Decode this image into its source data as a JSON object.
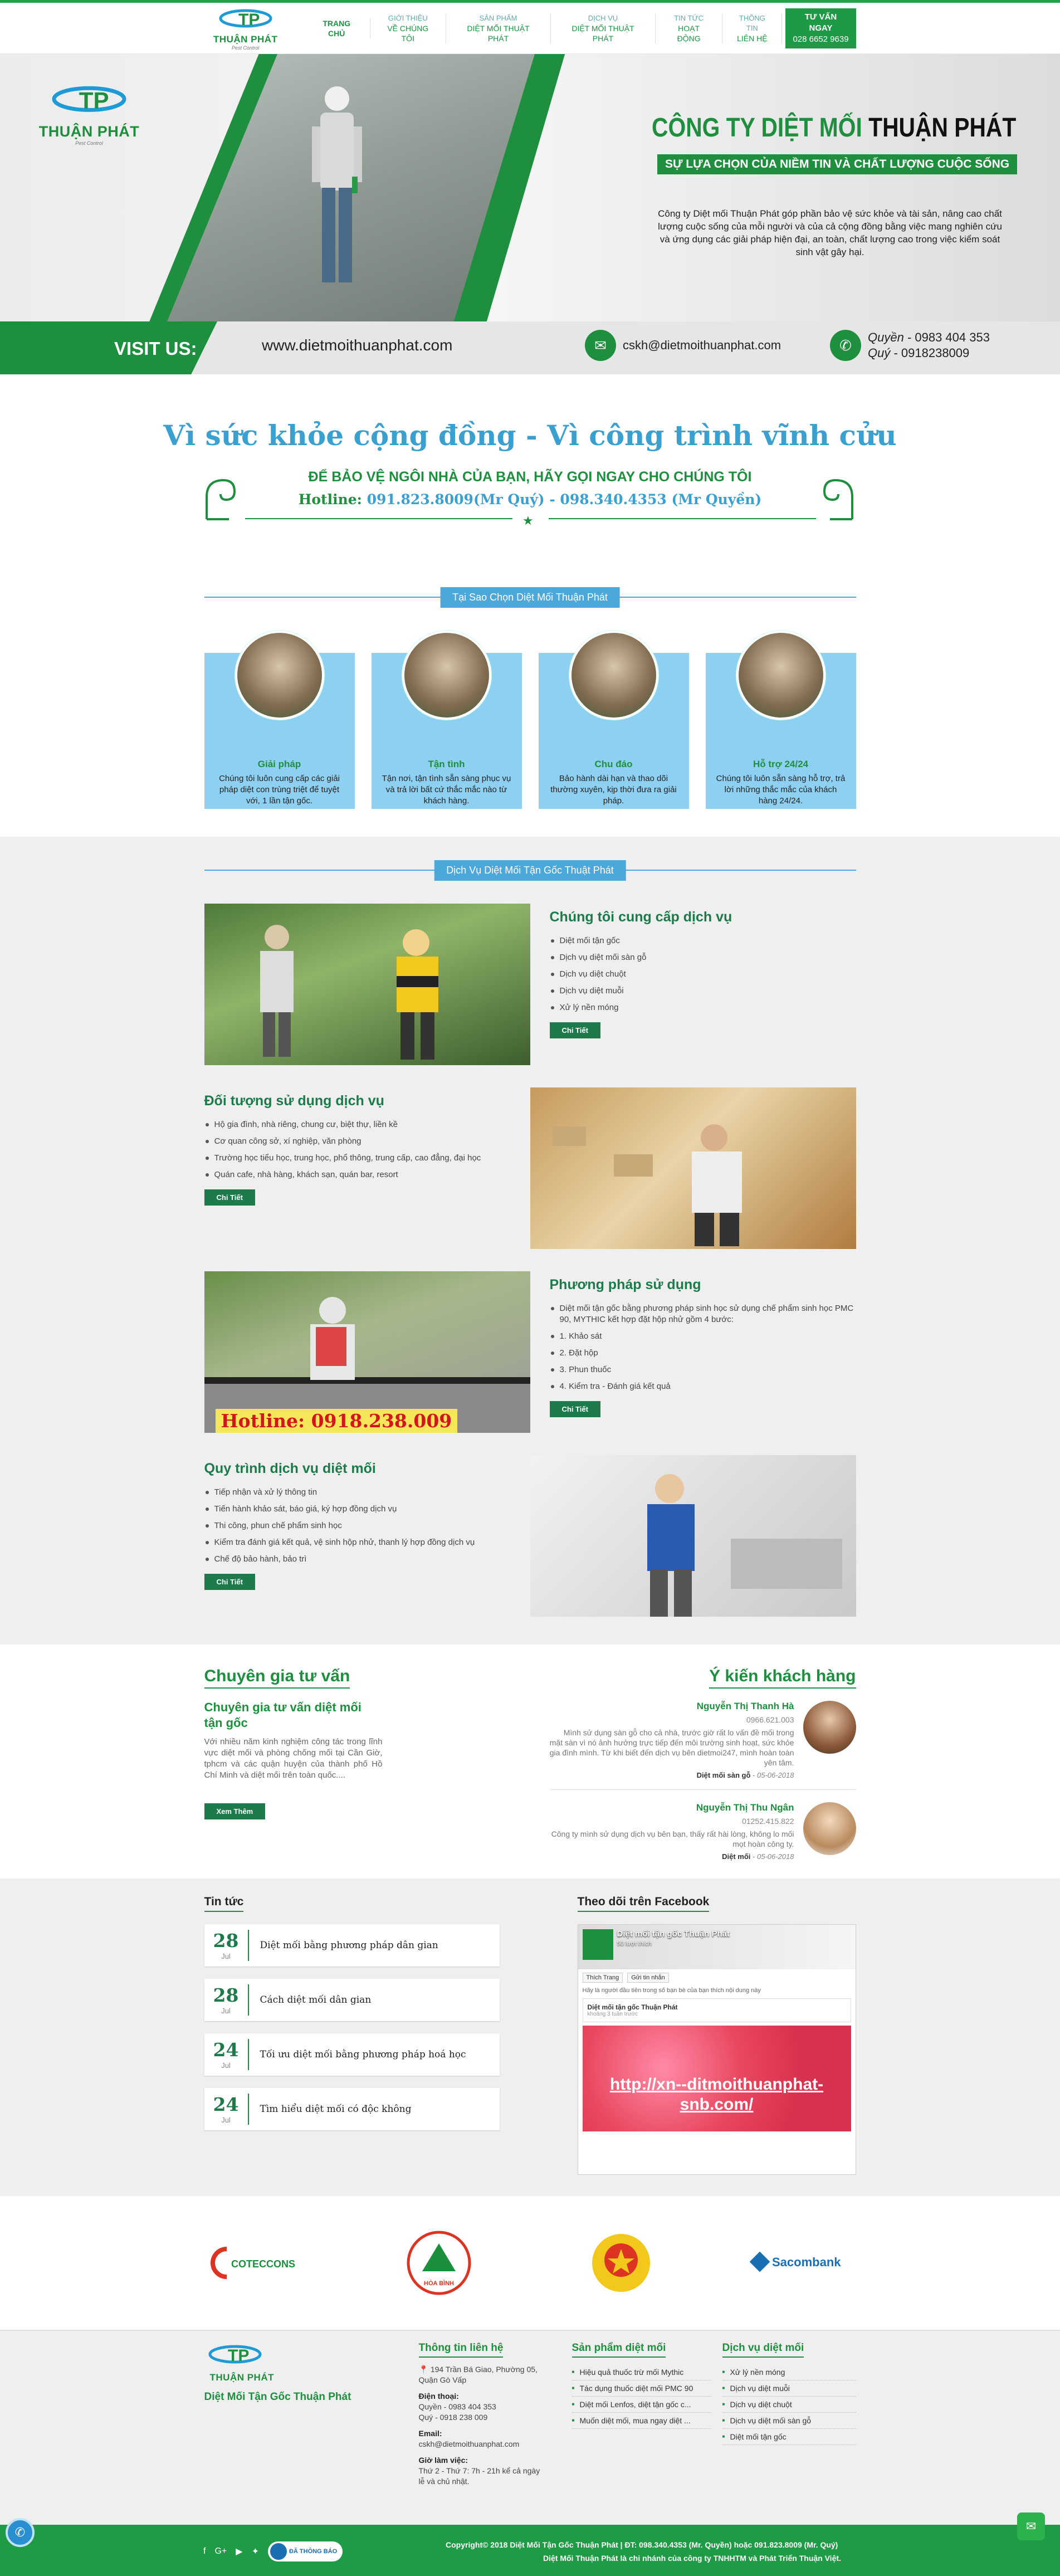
{
  "header": {
    "logo_text": "THUẬN PHÁT",
    "logo_sub": "Pest Control",
    "nav": [
      {
        "top": "TRANG CHỦ",
        "bottom": ""
      },
      {
        "top": "GIỚI THIỆU",
        "bottom": "VỀ CHÚNG TÔI"
      },
      {
        "top": "SẢN PHẨM",
        "bottom": "DIỆT MỐI THUẬT PHÁT"
      },
      {
        "top": "DỊCH VỤ",
        "bottom": "DIỆT MỐI THUẬT PHÁT"
      },
      {
        "top": "TIN TỨC",
        "bottom": "HOẠT ĐỘNG"
      },
      {
        "top": "THÔNG TIN",
        "bottom": "LIÊN HỆ"
      }
    ],
    "consult_label": "TƯ VẤN NGAY",
    "consult_phone": "028 6652 9639"
  },
  "hero": {
    "logo_text": "THUẬN PHÁT",
    "logo_sub": "Pest Control",
    "title_green": "CÔNG TY DIỆT MỐI",
    "title_dark": "THUẬN PHÁT",
    "slogan": "SỰ LỰA CHỌN CỦA NIỀM TIN VÀ CHẤT LƯỢNG CUỘC SỐNG",
    "description": "Công ty Diệt mối Thuận Phát góp phần bảo vệ sức khỏe và tài sản, nâng cao chất lượng cuộc sống của mỗi người và của cả cộng đồng bằng việc mang nghiên cứu và ứng dụng các giải pháp hiện đại, an toàn, chất lượng cao trong việc kiểm soát sinh vật gây hại.",
    "visit_label": "VISIT US:",
    "website": "www.dietmoithuanphat.com",
    "email": "cskh@dietmoithuanphat.com",
    "contact1_name": "Quyền",
    "contact1_phone": " - 0983 404 353",
    "contact2_name": "Quý",
    "contact2_phone": " - 0918238009"
  },
  "slogan": {
    "main": "Vì sức khỏe cộng đồng - Vì công trình vĩnh cửu",
    "sub": "ĐỂ BẢO VỆ NGÔI NHÀ CỦA BẠN, HÃY GỌI NGAY CHO CHÚNG TÔI",
    "hotline_label": "Hotline: ",
    "hotline_values": "091.823.8009(Mr Quý) - 098.340.4353 (Mr Quyền)"
  },
  "why": {
    "heading": "Tại Sao Chọn Diệt Mối Thuận Phát",
    "cards": [
      {
        "title": "Giải pháp",
        "text": "Chúng tôi luôn cung cấp các giải pháp diệt con trùng triệt để tuyệt với, 1 lần tận gốc."
      },
      {
        "title": "Tận tình",
        "text": "Tận nơi, tận tình sẵn sàng phục vụ và trả lời bất cứ thắc mắc nào từ khách hàng."
      },
      {
        "title": "Chu đáo",
        "text": "Bảo hành dài hạn và thao dõi thường xuyên, kịp thời đưa ra giải pháp."
      },
      {
        "title": "Hỗ trợ 24/24",
        "text": "Chúng tôi luôn sẵn sàng hỗ trợ, trả lời những thắc mắc của khách hàng 24/24."
      }
    ]
  },
  "services": {
    "heading": "Dịch Vụ Diệt Mối Tận Gốc Thuật Phát",
    "detail_label": "Chi Tiết",
    "hotline_overlay": "Hotline: 0918.238.009",
    "blocks": [
      {
        "title": "Chúng tôi cung cấp dịch vụ",
        "items": [
          "Diệt mối tận gốc",
          "Dịch vụ diệt mối sàn gỗ",
          "Dịch vụ diệt chuột",
          "Dịch vụ diệt muỗi",
          "Xử lý nền móng"
        ]
      },
      {
        "title": "Đối tượng sử dụng dịch vụ",
        "items": [
          "Hộ gia đình, nhà riêng, chung cư, biệt thự, liền kề",
          "Cơ quan công sở, xí nghiệp, văn phòng",
          "Trường học tiểu học, trung học, phổ thông, trung cấp, cao đẳng, đại học",
          "Quán cafe, nhà hàng, khách sạn, quán bar, resort"
        ]
      },
      {
        "title": "Phương pháp sử dụng",
        "items": [
          "Diệt mối tận gốc bằng phương pháp sinh học sử dụng chế phẩm sinh học PMC 90, MYTHIC kết hợp đặt hộp nhử gồm 4 bước:",
          "1. Khảo sát",
          "2. Đặt hộp",
          "3. Phun thuốc",
          "4. Kiểm tra - Đánh giá kết quả"
        ]
      },
      {
        "title": "Quy trình dịch vụ diệt mối",
        "items": [
          "Tiếp nhận và xử lý thông tin",
          "Tiến hành khảo sát, báo giá, ký hợp đồng dịch vụ",
          "Thi công, phun chế phẩm sinh học",
          "Kiểm tra đánh giá kết quả, vệ sinh hộp nhử, thanh lý hợp đồng dịch vụ",
          "Chế độ bảo hành, bảo trì"
        ]
      }
    ]
  },
  "expert": {
    "heading": "Chuyên gia tư vấn",
    "title": "Chuyên gia tư vấn diệt mối tận gốc",
    "text": "Với nhiều năm kinh nghiệm công tác trong lĩnh vực diệt mối và phòng chống mối tại Cần Giờ, tphcm và các quận huyện của thành phố Hồ Chí Minh và diệt mối trên toàn quốc....",
    "button": "Xem Thêm"
  },
  "feedback": {
    "heading": "Ý kiến khách hàng",
    "items": [
      {
        "name": "Nguyễn Thị Thanh Hà",
        "phone": "0966.621.003",
        "message": "Mình sử dụng sàn gỗ cho cả nhà, trước giờ rất lo vấn đề mối trong mặt sàn vì nó ảnh hưởng trực tiếp đến môi trường sinh hoạt, sức khỏe gia đình mình. Từ khi biết đến dịch vụ bên dietmoi247, mình hoàn toàn yên tâm.",
        "service": "Diệt mối sàn gỗ",
        "date": " - 05-06-2018"
      },
      {
        "name": "Nguyễn Thị Thu Ngân",
        "phone": "01252.415.822",
        "message": "Công ty mình sử dụng dịch vụ bên bạn, thấy rất hài lòng, không lo mối mọt hoàn công ty.",
        "service": "Diệt mối",
        "date": " - 05-06-2018"
      }
    ]
  },
  "news": {
    "heading": "Tin tức",
    "items": [
      {
        "day": "28",
        "month": "Jul",
        "title": "Diệt mối bằng phương pháp dân gian"
      },
      {
        "day": "28",
        "month": "Jul",
        "title": "Cách diệt mối dân gian"
      },
      {
        "day": "24",
        "month": "Jul",
        "title": "Tối ưu diệt mối bằng phương pháp hoá học"
      },
      {
        "day": "24",
        "month": "Jul",
        "title": "Tìm hiểu diệt mối có độc không"
      }
    ]
  },
  "facebook": {
    "heading": "Theo dõi trên Facebook",
    "page_name": "Diệt mối tận gốc Thuận Phát",
    "likes": "50 lượt thích",
    "like_btn": "Thích Trang",
    "share_btn": "Gửi tin nhắn",
    "first_to_like": "Hãy là người đầu tiên trong số bạn bè của bạn thích nội dung này",
    "post_author": "Diệt mối tận gốc Thuận Phát",
    "post_time": "khoảng 3 tuần trước",
    "link_text": "http://xn--ditmoithuanphat-snb.com/"
  },
  "footer": {
    "brand": "Diệt Mối Tận Gốc Thuận Phát",
    "contact_heading": "Thông tin liên hệ",
    "address": "194 Trần Bá Giao, Phường 05, Quận Gò Vấp",
    "phone_label": "Điện thoại:",
    "phone1": "Quyền - 0983 404 353",
    "phone2": "Quý - 0918 238 009",
    "email_label": "Email:",
    "email": "cskh@dietmoithuanphat.com",
    "hours_label": "Giờ làm việc:",
    "hours": "Thứ 2 - Thứ 7: 7h - 21h kể cả ngày lễ và chủ nhật.",
    "products_heading": "Sản phẩm diệt mối",
    "products": [
      "Hiệu quả thuốc trừ mối Mythic",
      "Tác dụng thuốc diệt mối PMC 90",
      "Diệt mối Lenfos, diệt tận gốc c...",
      "Muốn diệt mối, mua ngay diệt ..."
    ],
    "services_heading": "Dịch vụ diệt mối",
    "services": [
      "Xử lý nền móng",
      "Dịch vụ diệt muỗi",
      "Dịch vụ diệt chuột",
      "Dịch vụ diệt mối sàn gỗ",
      "Diệt mối tận gốc"
    ],
    "copyright1": "Copyright© 2018 Diệt Mối Tận Gốc Thuận Phát | ĐT: 098.340.4353 (Mr. Quyền) hoặc 091.823.8009 (Mr. Quý)",
    "copyright2": "Diệt Mối Thuận Phát là chi nhánh của công ty TNHHTM và Phát Triển Thuận Việt.",
    "verified_label": "ĐÃ THÔNG BÁO"
  },
  "partners": [
    "COTECCONS",
    "HÒA BÌNH",
    "",
    "Sacombank"
  ],
  "colors": {
    "green": "#1d8f3e",
    "blue": "#4ca8da",
    "light_blue": "#8ed0f2"
  }
}
